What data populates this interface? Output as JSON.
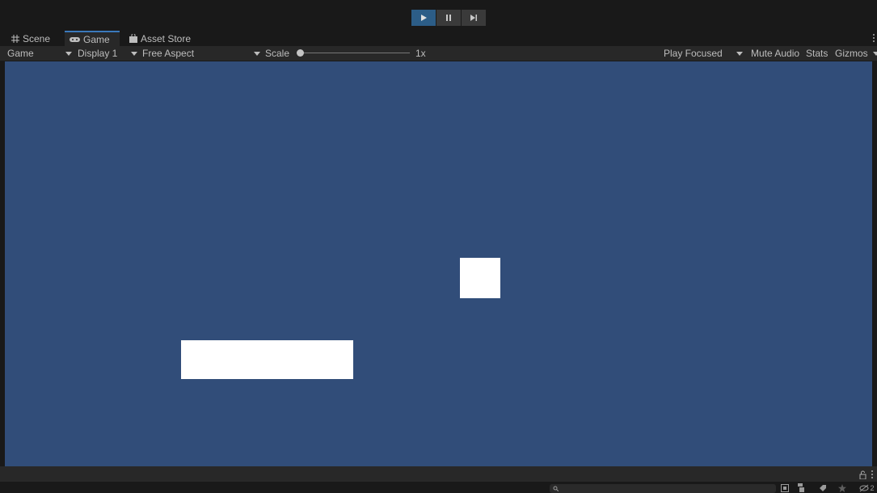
{
  "playbar": {
    "play_icon": "play-icon",
    "pause_icon": "pause-icon",
    "step_icon": "step-icon",
    "accent": "#2c5d87"
  },
  "tabs": [
    {
      "label": "Scene",
      "icon": "scene-grid-icon"
    },
    {
      "label": "Game",
      "icon": "game-controller-icon",
      "active": true
    },
    {
      "label": "Asset Store",
      "icon": "shopping-bag-icon"
    }
  ],
  "game_toolbar": {
    "mode_label": "Game",
    "display_label": "Display 1",
    "aspect_label": "Free Aspect",
    "scale_label": "Scale",
    "scale_value": "1x",
    "scale_fraction": 0.0,
    "play_focused_label": "Play Focused",
    "mute_audio_label": "Mute Audio",
    "stats_label": "Stats",
    "gizmos_label": "Gizmos"
  },
  "viewport": {
    "background": "#314d79",
    "objects": [
      "paddle",
      "ball"
    ],
    "object_color": "#ffffff"
  },
  "console": {
    "lock_icon": "lock-icon",
    "menu_icon": "kebab-menu-icon",
    "search_icon": "search-icon",
    "tool_icons": [
      "scene-view-icon",
      "hierarchy-icon",
      "tag-icon",
      "star-icon",
      "visibility-icon"
    ],
    "hidden_count": "2"
  }
}
